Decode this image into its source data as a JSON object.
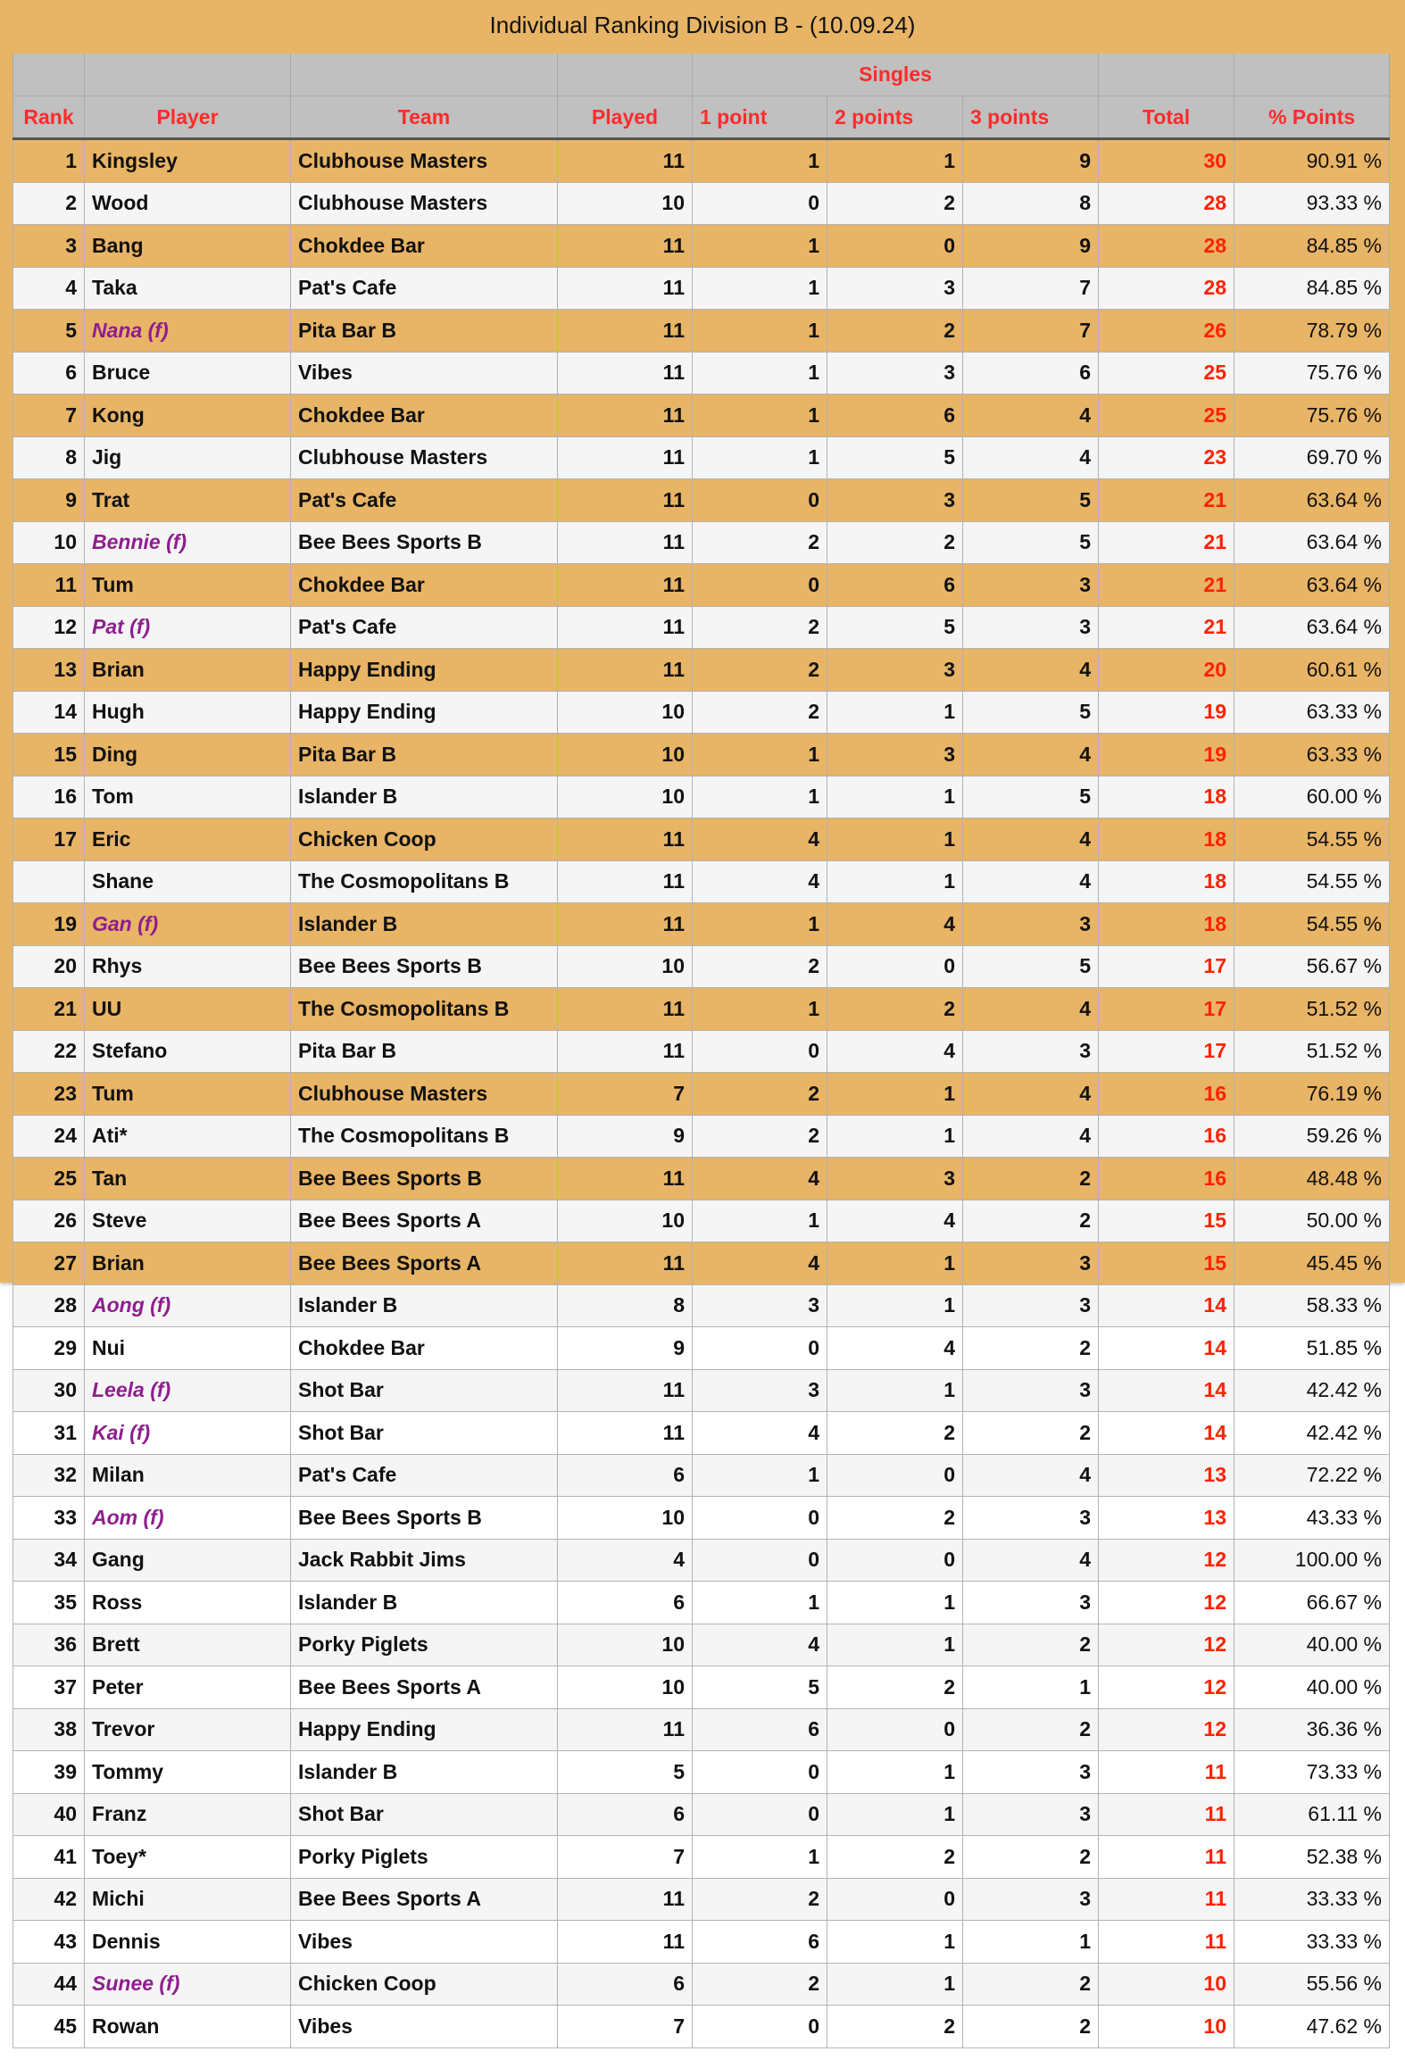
{
  "title": "Individual Ranking Division B  -  (10.09.24)",
  "header": {
    "group_label": "Singles",
    "columns": {
      "rank": "Rank",
      "player": "Player",
      "team": "Team",
      "played": "Played",
      "p1": "1 point",
      "p2": "2 points",
      "p3": "3 points",
      "total": "Total",
      "pct": "% Points"
    }
  },
  "colors": {
    "highlight_bg": "#e8b466",
    "header_bg": "#bfc0bf",
    "header_text": "#ff2b2b",
    "total_text": "#ff2200",
    "female_text": "#8e1e8e"
  },
  "rows": [
    {
      "rank": "1",
      "player": "Kingsley",
      "female": false,
      "team": "Clubhouse Masters",
      "played": "11",
      "p1": "1",
      "p2": "1",
      "p3": "9",
      "total": "30",
      "pct": "90.91 %",
      "style": "orange"
    },
    {
      "rank": "2",
      "player": "Wood",
      "female": false,
      "team": "Clubhouse Masters",
      "played": "10",
      "p1": "0",
      "p2": "2",
      "p3": "8",
      "total": "28",
      "pct": "93.33 %",
      "style": "light"
    },
    {
      "rank": "3",
      "player": "Bang",
      "female": false,
      "team": "Chokdee Bar",
      "played": "11",
      "p1": "1",
      "p2": "0",
      "p3": "9",
      "total": "28",
      "pct": "84.85 %",
      "style": "orange"
    },
    {
      "rank": "4",
      "player": "Taka",
      "female": false,
      "team": "Pat's Cafe",
      "played": "11",
      "p1": "1",
      "p2": "3",
      "p3": "7",
      "total": "28",
      "pct": "84.85 %",
      "style": "light"
    },
    {
      "rank": "5",
      "player": "Nana (f)",
      "female": true,
      "team": "Pita Bar B",
      "played": "11",
      "p1": "1",
      "p2": "2",
      "p3": "7",
      "total": "26",
      "pct": "78.79 %",
      "style": "orange"
    },
    {
      "rank": "6",
      "player": "Bruce",
      "female": false,
      "team": "Vibes",
      "played": "11",
      "p1": "1",
      "p2": "3",
      "p3": "6",
      "total": "25",
      "pct": "75.76 %",
      "style": "light"
    },
    {
      "rank": "7",
      "player": "Kong",
      "female": false,
      "team": "Chokdee Bar",
      "played": "11",
      "p1": "1",
      "p2": "6",
      "p3": "4",
      "total": "25",
      "pct": "75.76 %",
      "style": "orange"
    },
    {
      "rank": "8",
      "player": "Jig",
      "female": false,
      "team": "Clubhouse Masters",
      "played": "11",
      "p1": "1",
      "p2": "5",
      "p3": "4",
      "total": "23",
      "pct": "69.70 %",
      "style": "light"
    },
    {
      "rank": "9",
      "player": "Trat",
      "female": false,
      "team": "Pat's Cafe",
      "played": "11",
      "p1": "0",
      "p2": "3",
      "p3": "5",
      "total": "21",
      "pct": "63.64 %",
      "style": "orange"
    },
    {
      "rank": "10",
      "player": "Bennie (f)",
      "female": true,
      "team": "Bee Bees Sports B",
      "played": "11",
      "p1": "2",
      "p2": "2",
      "p3": "5",
      "total": "21",
      "pct": "63.64 %",
      "style": "light"
    },
    {
      "rank": "11",
      "player": "Tum",
      "female": false,
      "team": "Chokdee Bar",
      "played": "11",
      "p1": "0",
      "p2": "6",
      "p3": "3",
      "total": "21",
      "pct": "63.64 %",
      "style": "orange"
    },
    {
      "rank": "12",
      "player": "Pat (f)",
      "female": true,
      "team": "Pat's Cafe",
      "played": "11",
      "p1": "2",
      "p2": "5",
      "p3": "3",
      "total": "21",
      "pct": "63.64 %",
      "style": "light"
    },
    {
      "rank": "13",
      "player": "Brian",
      "female": false,
      "team": "Happy Ending",
      "played": "11",
      "p1": "2",
      "p2": "3",
      "p3": "4",
      "total": "20",
      "pct": "60.61 %",
      "style": "orange"
    },
    {
      "rank": "14",
      "player": "Hugh",
      "female": false,
      "team": "Happy Ending",
      "played": "10",
      "p1": "2",
      "p2": "1",
      "p3": "5",
      "total": "19",
      "pct": "63.33 %",
      "style": "light"
    },
    {
      "rank": "15",
      "player": "Ding",
      "female": false,
      "team": "Pita Bar B",
      "played": "10",
      "p1": "1",
      "p2": "3",
      "p3": "4",
      "total": "19",
      "pct": "63.33 %",
      "style": "orange"
    },
    {
      "rank": "16",
      "player": "Tom",
      "female": false,
      "team": "Islander B",
      "played": "10",
      "p1": "1",
      "p2": "1",
      "p3": "5",
      "total": "18",
      "pct": "60.00 %",
      "style": "light"
    },
    {
      "rank": "17",
      "player": "Eric",
      "female": false,
      "team": "Chicken Coop",
      "played": "11",
      "p1": "4",
      "p2": "1",
      "p3": "4",
      "total": "18",
      "pct": "54.55 %",
      "style": "orange"
    },
    {
      "rank": "",
      "player": "Shane",
      "female": false,
      "team": "The Cosmopolitans B",
      "played": "11",
      "p1": "4",
      "p2": "1",
      "p3": "4",
      "total": "18",
      "pct": "54.55 %",
      "style": "light"
    },
    {
      "rank": "19",
      "player": "Gan (f)",
      "female": true,
      "team": "Islander B",
      "played": "11",
      "p1": "1",
      "p2": "4",
      "p3": "3",
      "total": "18",
      "pct": "54.55 %",
      "style": "orange"
    },
    {
      "rank": "20",
      "player": "Rhys",
      "female": false,
      "team": "Bee Bees Sports B",
      "played": "10",
      "p1": "2",
      "p2": "0",
      "p3": "5",
      "total": "17",
      "pct": "56.67 %",
      "style": "light"
    },
    {
      "rank": "21",
      "player": "UU",
      "female": false,
      "team": "The Cosmopolitans B",
      "played": "11",
      "p1": "1",
      "p2": "2",
      "p3": "4",
      "total": "17",
      "pct": "51.52 %",
      "style": "orange"
    },
    {
      "rank": "22",
      "player": "Stefano",
      "female": false,
      "team": "Pita Bar B",
      "played": "11",
      "p1": "0",
      "p2": "4",
      "p3": "3",
      "total": "17",
      "pct": "51.52 %",
      "style": "light"
    },
    {
      "rank": "23",
      "player": "Tum",
      "female": false,
      "team": "Clubhouse Masters",
      "played": "7",
      "p1": "2",
      "p2": "1",
      "p3": "4",
      "total": "16",
      "pct": "76.19 %",
      "style": "orange"
    },
    {
      "rank": "24",
      "player": "Ati*",
      "female": false,
      "team": "The Cosmopolitans B",
      "played": "9",
      "p1": "2",
      "p2": "1",
      "p3": "4",
      "total": "16",
      "pct": "59.26 %",
      "style": "light"
    },
    {
      "rank": "25",
      "player": "Tan",
      "female": false,
      "team": "Bee Bees Sports B",
      "played": "11",
      "p1": "4",
      "p2": "3",
      "p3": "2",
      "total": "16",
      "pct": "48.48 %",
      "style": "orange"
    },
    {
      "rank": "26",
      "player": "Steve",
      "female": false,
      "team": "Bee Bees Sports A",
      "played": "10",
      "p1": "1",
      "p2": "4",
      "p3": "2",
      "total": "15",
      "pct": "50.00 %",
      "style": "light"
    },
    {
      "rank": "27",
      "player": "Brian",
      "female": false,
      "team": "Bee Bees Sports A",
      "played": "11",
      "p1": "4",
      "p2": "1",
      "p3": "3",
      "total": "15",
      "pct": "45.45 %",
      "style": "orange"
    },
    {
      "rank": "28",
      "player": "Aong (f)",
      "female": true,
      "team": "Islander B",
      "played": "8",
      "p1": "3",
      "p2": "1",
      "p3": "3",
      "total": "14",
      "pct": "58.33 %",
      "style": "light"
    },
    {
      "rank": "29",
      "player": "Nui",
      "female": false,
      "team": "Chokdee Bar",
      "played": "9",
      "p1": "0",
      "p2": "4",
      "p3": "2",
      "total": "14",
      "pct": "51.85 %",
      "style": "white"
    },
    {
      "rank": "30",
      "player": "Leela (f)",
      "female": true,
      "team": "Shot Bar",
      "played": "11",
      "p1": "3",
      "p2": "1",
      "p3": "3",
      "total": "14",
      "pct": "42.42 %",
      "style": "light"
    },
    {
      "rank": "31",
      "player": "Kai (f)",
      "female": true,
      "team": "Shot Bar",
      "played": "11",
      "p1": "4",
      "p2": "2",
      "p3": "2",
      "total": "14",
      "pct": "42.42 %",
      "style": "white"
    },
    {
      "rank": "32",
      "player": "Milan",
      "female": false,
      "team": "Pat's Cafe",
      "played": "6",
      "p1": "1",
      "p2": "0",
      "p3": "4",
      "total": "13",
      "pct": "72.22 %",
      "style": "light"
    },
    {
      "rank": "33",
      "player": "Aom (f)",
      "female": true,
      "team": "Bee Bees Sports B",
      "played": "10",
      "p1": "0",
      "p2": "2",
      "p3": "3",
      "total": "13",
      "pct": "43.33 %",
      "style": "white"
    },
    {
      "rank": "34",
      "player": "Gang",
      "female": false,
      "team": "Jack Rabbit Jims",
      "played": "4",
      "p1": "0",
      "p2": "0",
      "p3": "4",
      "total": "12",
      "pct": "100.00 %",
      "style": "light"
    },
    {
      "rank": "35",
      "player": "Ross",
      "female": false,
      "team": "Islander B",
      "played": "6",
      "p1": "1",
      "p2": "1",
      "p3": "3",
      "total": "12",
      "pct": "66.67 %",
      "style": "white"
    },
    {
      "rank": "36",
      "player": "Brett",
      "female": false,
      "team": "Porky Piglets",
      "played": "10",
      "p1": "4",
      "p2": "1",
      "p3": "2",
      "total": "12",
      "pct": "40.00 %",
      "style": "light"
    },
    {
      "rank": "37",
      "player": "Peter",
      "female": false,
      "team": "Bee Bees Sports A",
      "played": "10",
      "p1": "5",
      "p2": "2",
      "p3": "1",
      "total": "12",
      "pct": "40.00 %",
      "style": "white"
    },
    {
      "rank": "38",
      "player": "Trevor",
      "female": false,
      "team": "Happy Ending",
      "played": "11",
      "p1": "6",
      "p2": "0",
      "p3": "2",
      "total": "12",
      "pct": "36.36 %",
      "style": "light"
    },
    {
      "rank": "39",
      "player": "Tommy",
      "female": false,
      "team": "Islander B",
      "played": "5",
      "p1": "0",
      "p2": "1",
      "p3": "3",
      "total": "11",
      "pct": "73.33 %",
      "style": "white"
    },
    {
      "rank": "40",
      "player": "Franz",
      "female": false,
      "team": "Shot Bar",
      "played": "6",
      "p1": "0",
      "p2": "1",
      "p3": "3",
      "total": "11",
      "pct": "61.11 %",
      "style": "light"
    },
    {
      "rank": "41",
      "player": "Toey*",
      "female": false,
      "team": "Porky Piglets",
      "played": "7",
      "p1": "1",
      "p2": "2",
      "p3": "2",
      "total": "11",
      "pct": "52.38 %",
      "style": "white"
    },
    {
      "rank": "42",
      "player": "Michi",
      "female": false,
      "team": "Bee Bees Sports A",
      "played": "11",
      "p1": "2",
      "p2": "0",
      "p3": "3",
      "total": "11",
      "pct": "33.33 %",
      "style": "light"
    },
    {
      "rank": "43",
      "player": "Dennis",
      "female": false,
      "team": "Vibes",
      "played": "11",
      "p1": "6",
      "p2": "1",
      "p3": "1",
      "total": "11",
      "pct": "33.33 %",
      "style": "white"
    },
    {
      "rank": "44",
      "player": "Sunee (f)",
      "female": true,
      "team": "Chicken Coop",
      "played": "6",
      "p1": "2",
      "p2": "1",
      "p3": "2",
      "total": "10",
      "pct": "55.56 %",
      "style": "light"
    },
    {
      "rank": "45",
      "player": "Rowan",
      "female": false,
      "team": "Vibes",
      "played": "7",
      "p1": "0",
      "p2": "2",
      "p3": "2",
      "total": "10",
      "pct": "47.62 %",
      "style": "white"
    }
  ]
}
